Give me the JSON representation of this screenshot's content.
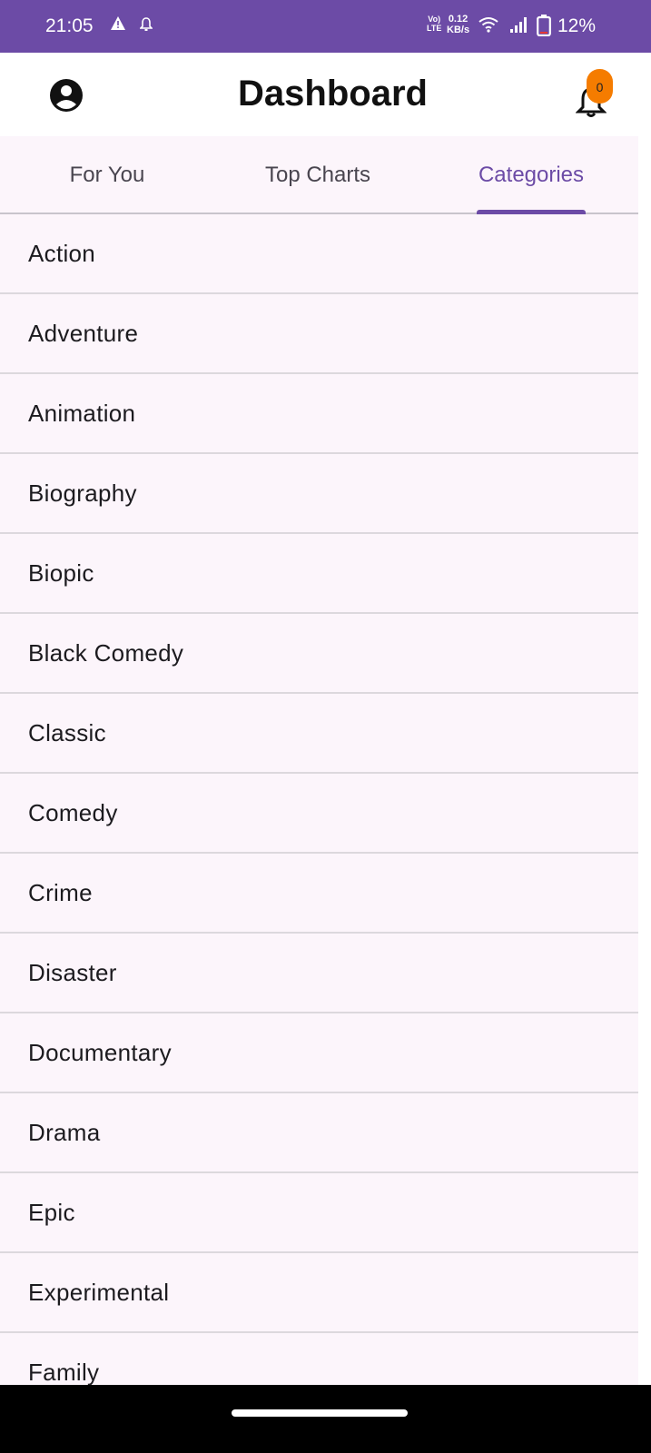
{
  "status_bar": {
    "time": "21:05",
    "volte_top": "Vo)",
    "volte_bottom": "LTE",
    "speed_value": "0.12",
    "speed_unit": "KB/s",
    "battery": "12%"
  },
  "app_bar": {
    "title": "Dashboard",
    "notification_count": "0",
    "icons": [
      "account-icon",
      "bell-icon"
    ]
  },
  "tabs": [
    {
      "label": "For You",
      "active": false
    },
    {
      "label": "Top Charts",
      "active": false
    },
    {
      "label": "Categories",
      "active": true
    }
  ],
  "categories": [
    "Action",
    "Adventure",
    "Animation",
    "Biography",
    "Biopic",
    "Black Comedy",
    "Classic",
    "Comedy",
    "Crime",
    "Disaster",
    "Documentary",
    "Drama",
    "Epic",
    "Experimental",
    "Family"
  ],
  "colors": {
    "primary": "#6c4ba6",
    "badge": "#f57c00",
    "background": "#fcf5fb"
  }
}
